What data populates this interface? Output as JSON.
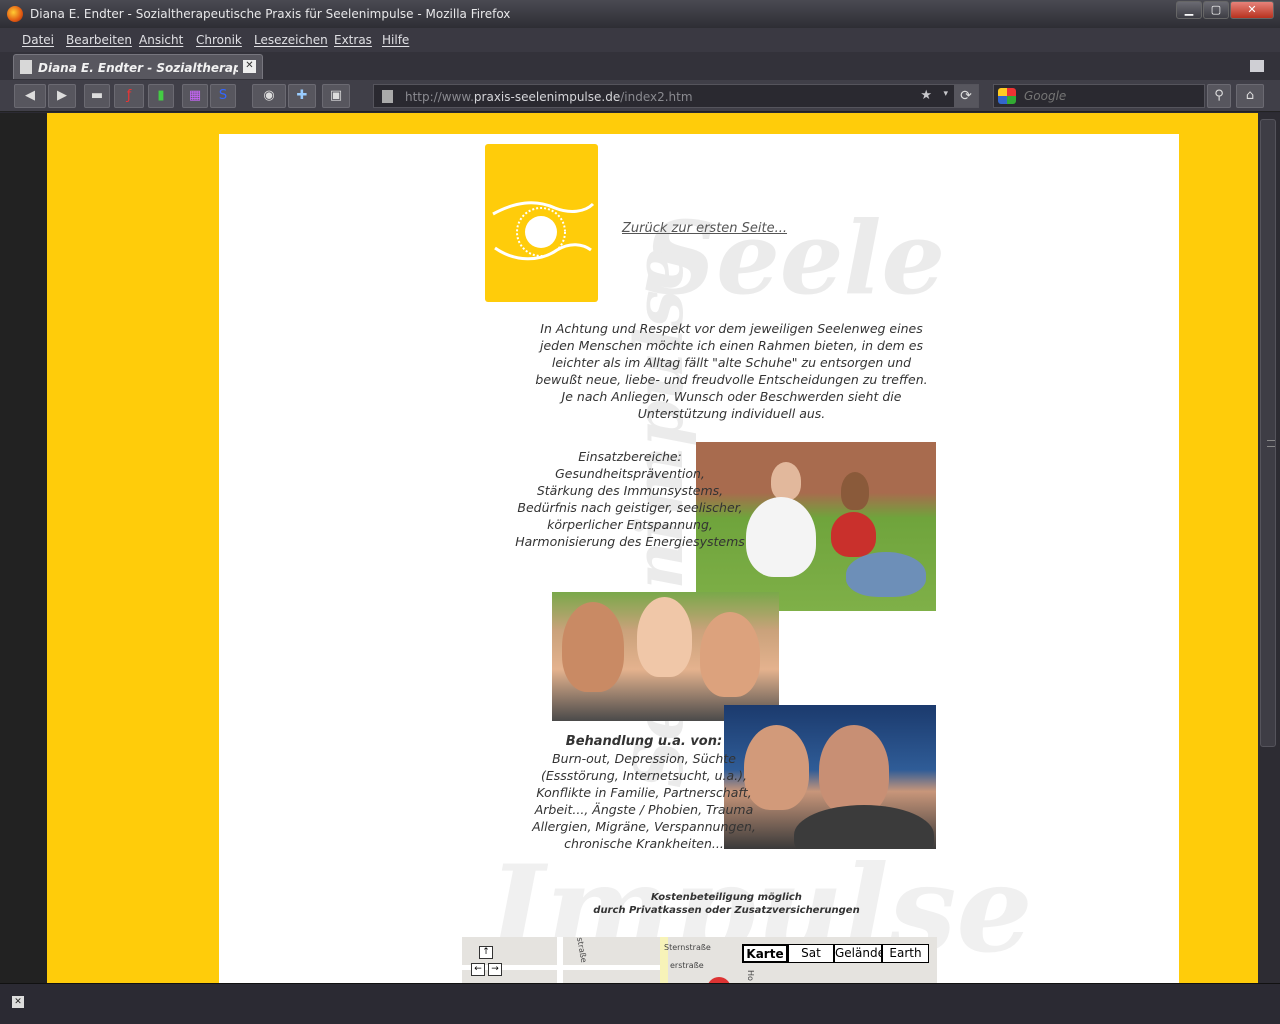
{
  "window": {
    "title": "Diana E. Endter - Sozialtherapeutische Praxis für Seelenimpulse - Mozilla Firefox",
    "minimize": "▁",
    "maximize": "▢",
    "close": "✕"
  },
  "menu": [
    "Datei",
    "Bearbeiten",
    "Ansicht",
    "Chronik",
    "Lesezeichen",
    "Extras",
    "Hilfe"
  ],
  "tab": {
    "title": "Diana E. Endter - Sozialtherapeuti...",
    "close": "✕"
  },
  "navbar": {
    "url_prefix": "http://www.",
    "url_host": "praxis-seelenimpulse.de",
    "url_path": "/index2.htm",
    "search_placeholder": "Google",
    "star": "★",
    "dropdown": "▾",
    "reload": "⟳"
  },
  "page": {
    "back_link": "Zurück zur ersten Seite...",
    "intro": "In Achtung und Respekt vor dem jeweiligen Seelenweg eines jeden Menschen möchte ich einen Rahmen bieten, in dem es leichter als im Alltag fällt \"alte Schuhe\" zu entsorgen und bewußt neue, liebe- und freudvolle Entscheidungen zu treffen. Je nach Anliegen, Wunsch oder Beschwerden sieht die Unterstützung individuell aus.",
    "einsatz_lines": [
      "Einsatzbereiche:",
      "Gesundheitsprävention,",
      "Stärkung des Immunsystems,",
      "Bedürfnis nach geistiger, seelischer,",
      "körperlicher Entspannung,",
      "Harmonisierung des Energiesystems"
    ],
    "behandlung_title": "Behandlung u.a. von:",
    "behandlung_lines": [
      "Burn-out, Depression, Süchte",
      "(Essstörung, Internetsucht, u.a.),",
      "Konflikte in Familie, Partnerschaft,",
      "Arbeit..., Ängste / Phobien, Trauma",
      "Allergien, Migräne, Verspannungen,",
      "chronische Krankheiten..."
    ],
    "kosten_line1": "Kostenbeteiligung möglich",
    "kosten_line2": "durch Privatkassen oder Zusatzversicherungen",
    "map": {
      "types": [
        "Karte",
        "Sat",
        "Gelände",
        "Earth"
      ],
      "streets": [
        "ustraße",
        "Sternstraße",
        "erstraße",
        "Ho"
      ],
      "nav_up": "↑",
      "nav_left": "←",
      "nav_right": "→"
    }
  },
  "colors": {
    "brand_yellow": "#ffcc0a",
    "chrome_dark": "#2b2a33"
  },
  "status": {
    "close": "✕"
  }
}
